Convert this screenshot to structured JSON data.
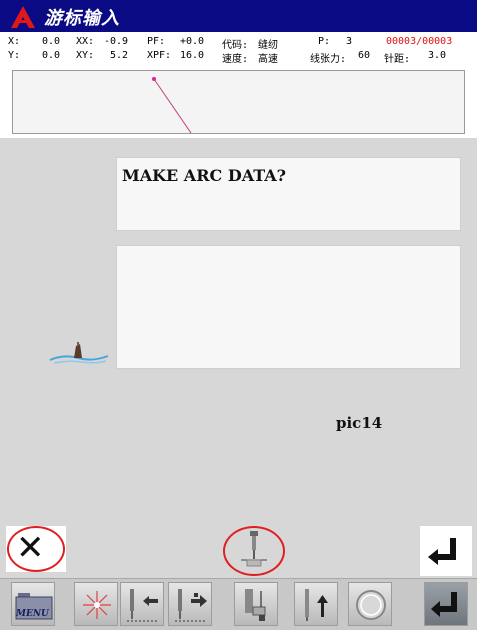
{
  "window": {
    "title": "游标输入"
  },
  "status": {
    "x": {
      "label": "X:",
      "value": "0.0"
    },
    "y": {
      "label": "Y:",
      "value": "0.0"
    },
    "xx": {
      "label": "XX:",
      "value": "-0.9"
    },
    "xy": {
      "label": "XY:",
      "value": "5.2"
    },
    "pf": {
      "label": "PF:",
      "value": "+0.0"
    },
    "xpf": {
      "label": "XPF:",
      "value": "16.0"
    },
    "code": {
      "label": "代码:",
      "value": "缝纫"
    },
    "speed": {
      "label": "速度:",
      "value": "高速"
    },
    "p": {
      "label": "P:",
      "value": "3"
    },
    "tension": {
      "label": "线张力:",
      "value": "60"
    },
    "counter": "00003/00003",
    "stitch": {
      "label": "针距:",
      "value": "3.0"
    }
  },
  "main": {
    "message": "MAKE ARC DATA?",
    "input_value": "",
    "pic_label": "pic14"
  },
  "icons": {
    "logo": "company-logo",
    "cancel": "close-icon",
    "needle": "needle-icon",
    "enter": "enter-icon",
    "menu": "menu-icon",
    "sparkle": "origin-icon",
    "needle_back": "needle-back-icon",
    "needle_forward": "needle-forward-icon",
    "presser": "presser-foot-icon",
    "needle_up": "needle-up-icon",
    "circle": "circle-icon",
    "toolbar_enter": "enter-icon"
  },
  "toolbar": {
    "menu_label": "MENU"
  },
  "colors": {
    "titlebar": "#0a0a84",
    "counter": "#e01010",
    "highlight": "#e02020",
    "background": "#d7d7d7"
  }
}
